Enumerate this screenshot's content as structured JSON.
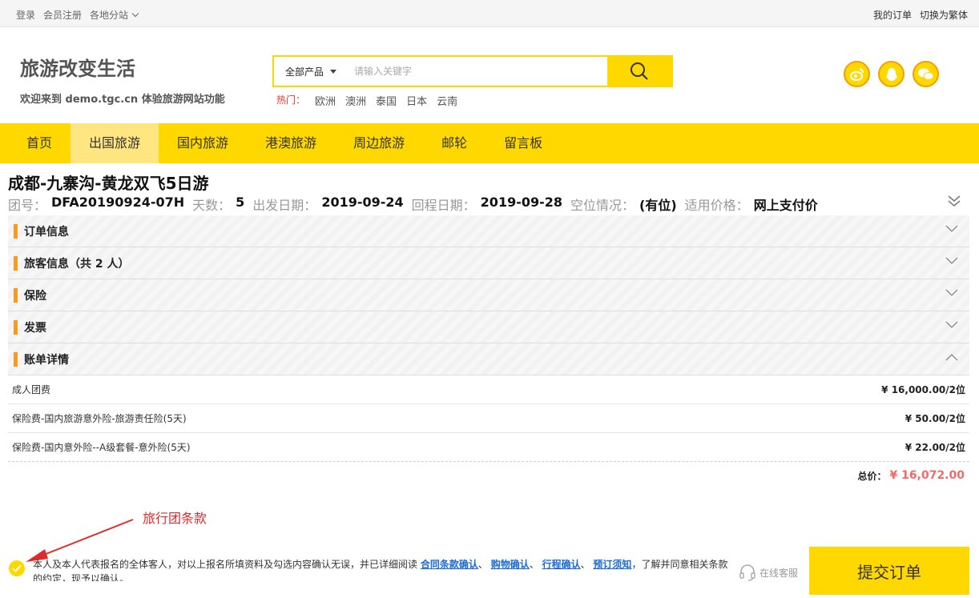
{
  "topbar": {
    "login": "登录",
    "register": "会员注册",
    "branches": "各地分站",
    "my_orders": "我的订单",
    "switch_trad": "切换为繁体"
  },
  "header": {
    "slogan": "旅游改变生活",
    "welcome": "欢迎来到 demo.tgc.cn 体验旅游网站功能",
    "search": {
      "category": "全部产品",
      "placeholder": "请输入关键字"
    },
    "hot": {
      "label": "热门：",
      "items": [
        "欧洲",
        "澳洲",
        "泰国",
        "日本",
        "云南"
      ]
    },
    "social_icons": [
      "weibo-icon",
      "qq-icon",
      "wechat-icon"
    ]
  },
  "nav": {
    "items": [
      "首页",
      "出国旅游",
      "国内旅游",
      "港澳旅游",
      "周边旅游",
      "邮轮",
      "留言板"
    ],
    "active": "出国旅游"
  },
  "product": {
    "title": "成都-九寨沟-黄龙双飞5日游",
    "meta": {
      "group_no_label": "团号：",
      "group_no": "DFA20190924-07H",
      "days_label": "天数：",
      "days": "5",
      "depart_label": "出发日期：",
      "depart": "2019-09-24",
      "return_label": "回程日期：",
      "return": "2019-09-28",
      "seats_label": "空位情况：",
      "seats": "(有位)",
      "price_label": "适用价格：",
      "price_type": "网上支付价"
    }
  },
  "sections": [
    {
      "name": "订单信息",
      "expanded": false
    },
    {
      "name": "旅客信息（共 2 人）",
      "expanded": false
    },
    {
      "name": "保险",
      "expanded": false
    },
    {
      "name": "发票",
      "expanded": false
    },
    {
      "name": "账单详情",
      "expanded": true
    }
  ],
  "bill": {
    "rows": [
      {
        "item": "成人团费",
        "amount": "¥ 16,000.00/2位"
      },
      {
        "item": "保险费-国内旅游意外险-旅游责任险(5天)",
        "amount": "¥ 50.00/2位"
      },
      {
        "item": "保险费-国内意外险--A级套餐-意外险(5天)",
        "amount": "¥ 22.00/2位"
      }
    ],
    "total_label": "总价：",
    "total_value": "¥ 16,072.00"
  },
  "annotation": "旅行团条款",
  "footer": {
    "agree_prefix": "本人及本人代表报名的全体客人，对以上报名所填资料及勾选内容确认无误，并已详细阅读",
    "links": [
      "合同条款确认",
      "购物确认",
      "行程确认",
      "预订须知"
    ],
    "sep": "、",
    "agree_suffix": "，了解并同意相关条款的约定，现予以确认。",
    "service": "在线客服",
    "submit": "提交订单"
  },
  "colors": {
    "accent": "#ffd800",
    "section_bar": "#f79a1e",
    "total_price": "#f06a6a",
    "link": "#1a6bd8",
    "annotation": "#e02b2b"
  }
}
